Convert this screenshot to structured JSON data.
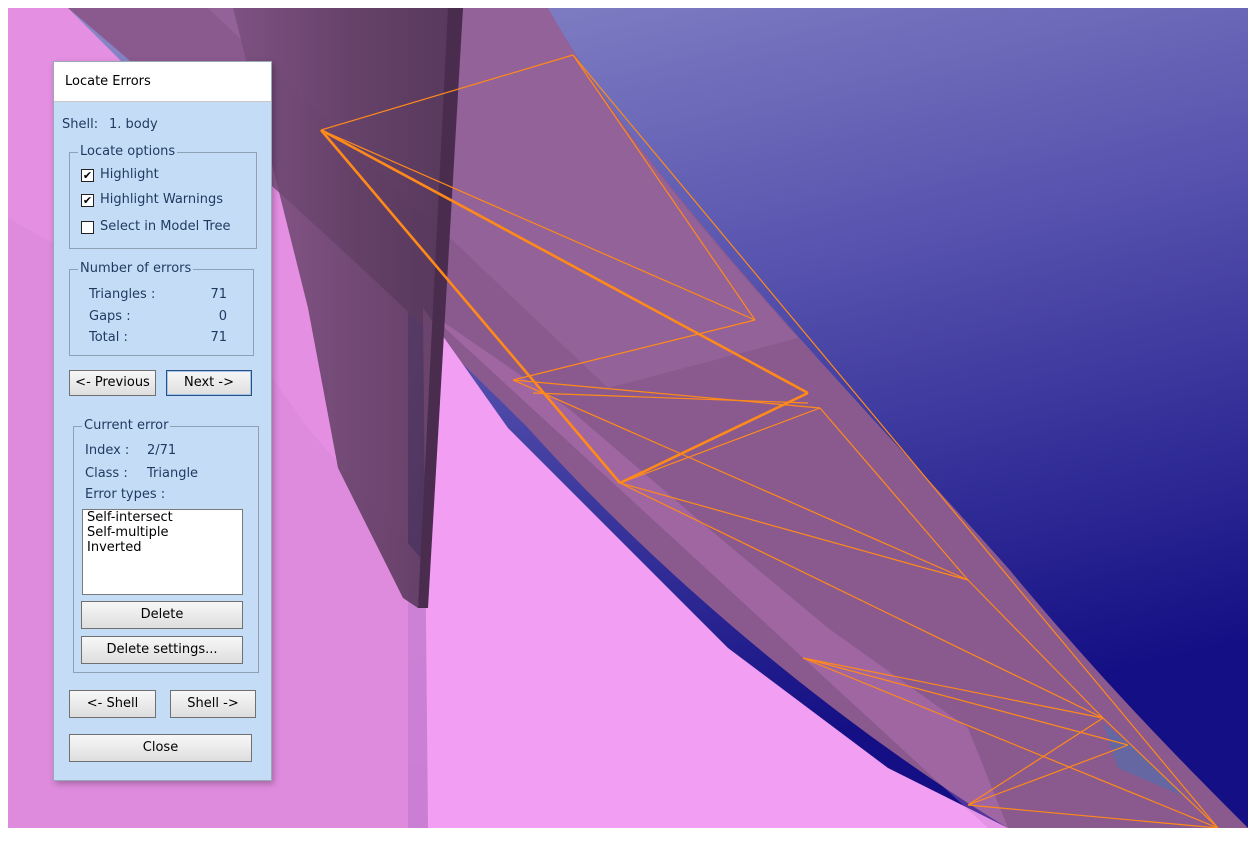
{
  "dialog": {
    "title": "Locate Errors",
    "shell_label": "Shell:",
    "shell_value": "1. body",
    "locate_options": {
      "title": "Locate options",
      "highlight": {
        "label": "Highlight",
        "checked": true
      },
      "highlight_warnings": {
        "label": "Highlight Warnings",
        "checked": true
      },
      "select_in_model_tree": {
        "label": "Select in Model Tree",
        "checked": false
      }
    },
    "number_of_errors": {
      "title": "Number of errors",
      "triangles_label": "Triangles :",
      "triangles_value": "71",
      "gaps_label": "Gaps :",
      "gaps_value": "0",
      "total_label": "Total :",
      "total_value": "71"
    },
    "nav": {
      "previous": "<- Previous",
      "next": "Next ->"
    },
    "current_error": {
      "title": "Current error",
      "index_label": "Index :",
      "index_value": "2/71",
      "class_label": "Class :",
      "class_value": "Triangle",
      "error_types_label": "Error types :",
      "error_types": [
        "Self-intersect",
        "Self-multiple",
        "Inverted"
      ],
      "delete": "Delete",
      "delete_settings": "Delete settings..."
    },
    "shell_nav": {
      "prev": "<- Shell",
      "next": "Shell ->"
    },
    "close": "Close"
  },
  "colors": {
    "dialog_bg": "#c5dcf7",
    "mesh_edge": "#ff8a00",
    "background_top": "#8a8ac8",
    "background_bottom": "#1a1580",
    "pink_surface": "#f29ef0",
    "purple_surface": "#8a5a8e"
  }
}
